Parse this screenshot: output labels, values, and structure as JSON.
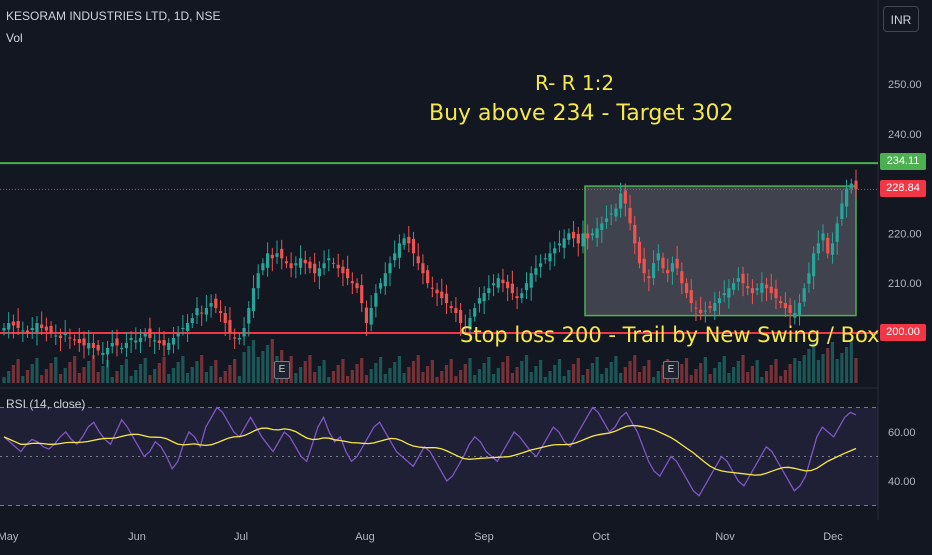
{
  "header": {
    "title": "KESORAM INDUSTRIES LTD, 1D, NSE",
    "vol_label": "Vol",
    "currency": "INR"
  },
  "annotations": {
    "risk_reward": "R- R 1:2",
    "buy_target": "Buy above 234 - Target 302",
    "stop_loss": "Stop loss 200 -  Trail by New Swing / Box"
  },
  "price_tags": {
    "resistance": "234.11",
    "last_price": "228.84",
    "support": "200.00"
  },
  "earnings_markers": [
    "E",
    "E"
  ],
  "rsi": {
    "label": "RSI (14, close)"
  },
  "colors": {
    "background": "#131722",
    "up": "#26a69a",
    "down": "#ef5350",
    "resistance_line": "#4caf50",
    "support_line": "#f23645",
    "annotation_text": "#f5e94a",
    "rsi_line": "#7e57c2",
    "rsi_ma": "#f5e94a"
  },
  "chart_data": [
    {
      "type": "candlestick",
      "title": "KESORAM INDUSTRIES LTD, 1D, NSE",
      "x_tick_labels": [
        "May",
        "Jun",
        "Jul",
        "Aug",
        "Sep",
        "Oct",
        "Nov",
        "Dec"
      ],
      "y_tick_labels": [
        "250.00",
        "240.00",
        "230.00",
        "220.00",
        "210.00",
        "200.00"
      ],
      "ylim": [
        195,
        256
      ],
      "ohlc_close": [
        201,
        202,
        201.5,
        201,
        200.5,
        200,
        201,
        202,
        201,
        200.5,
        200,
        199.5,
        199,
        200,
        199,
        198.5,
        198,
        197.5,
        198,
        197,
        196.5,
        196,
        197,
        198,
        197.5,
        197,
        198,
        199,
        198.5,
        199,
        200,
        199,
        198.5,
        198,
        197.5,
        198,
        199,
        200,
        201,
        202,
        203,
        205,
        204,
        205,
        206,
        205,
        204,
        202,
        200,
        199,
        199,
        201,
        205,
        209,
        212,
        214,
        216,
        215,
        216,
        215,
        214,
        213,
        214,
        215,
        214,
        213,
        212,
        213,
        214,
        215,
        214,
        213,
        212,
        211,
        210,
        209,
        206,
        202,
        205,
        208,
        210,
        212,
        214,
        216,
        218,
        219,
        218,
        216,
        214,
        212,
        210,
        209,
        208,
        207,
        206,
        205,
        204,
        202,
        201,
        203,
        205,
        207,
        208,
        209,
        210,
        211,
        210,
        209,
        208,
        207,
        208,
        210,
        212,
        213,
        214,
        215,
        216,
        217,
        218,
        219,
        220,
        219,
        218,
        220,
        219,
        220,
        221,
        222,
        223,
        224,
        225,
        228,
        226,
        222,
        218,
        214,
        212,
        211,
        214,
        216,
        213,
        212,
        214,
        213,
        210,
        208,
        206,
        205,
        204,
        204.5,
        205,
        206,
        207,
        208,
        209,
        210,
        211,
        210,
        209,
        208,
        209,
        210,
        209,
        208,
        207,
        206,
        205,
        204,
        204,
        206,
        209,
        212,
        216,
        218,
        220,
        216,
        218,
        222,
        226,
        229,
        230,
        228.84
      ],
      "rsi_ylim": [
        28,
        75
      ],
      "rsi_tick_labels": [
        "60.00",
        "40.00"
      ],
      "rsi_values": [
        58,
        56,
        54,
        52,
        55,
        57,
        56,
        54,
        53,
        55,
        58,
        60,
        57,
        55,
        58,
        62,
        64,
        60,
        57,
        55,
        60,
        65,
        62,
        58,
        54,
        50,
        52,
        56,
        54,
        50,
        45,
        48,
        55,
        60,
        58,
        54,
        62,
        66,
        70,
        68,
        64,
        60,
        58,
        62,
        66,
        62,
        58,
        55,
        52,
        56,
        60,
        58,
        54,
        50,
        48,
        55,
        62,
        66,
        60,
        56,
        58,
        52,
        48,
        50,
        54,
        58,
        62,
        64,
        60,
        56,
        52,
        50,
        48,
        46,
        50,
        54,
        52,
        48,
        44,
        40,
        42,
        46,
        50,
        55,
        58,
        56,
        52,
        50,
        48,
        52,
        56,
        60,
        58,
        55,
        52,
        50,
        54,
        58,
        62,
        60,
        56,
        54,
        58,
        62,
        66,
        70,
        68,
        64,
        60,
        62,
        66,
        68,
        64,
        60,
        54,
        48,
        44,
        42,
        46,
        50,
        48,
        44,
        40,
        36,
        34,
        38,
        42,
        46,
        50,
        48,
        44,
        40,
        38,
        42,
        46,
        50,
        54,
        52,
        48,
        44,
        40,
        36,
        38,
        42,
        50,
        58,
        62,
        60,
        58,
        62,
        66,
        68,
        67
      ]
    }
  ]
}
